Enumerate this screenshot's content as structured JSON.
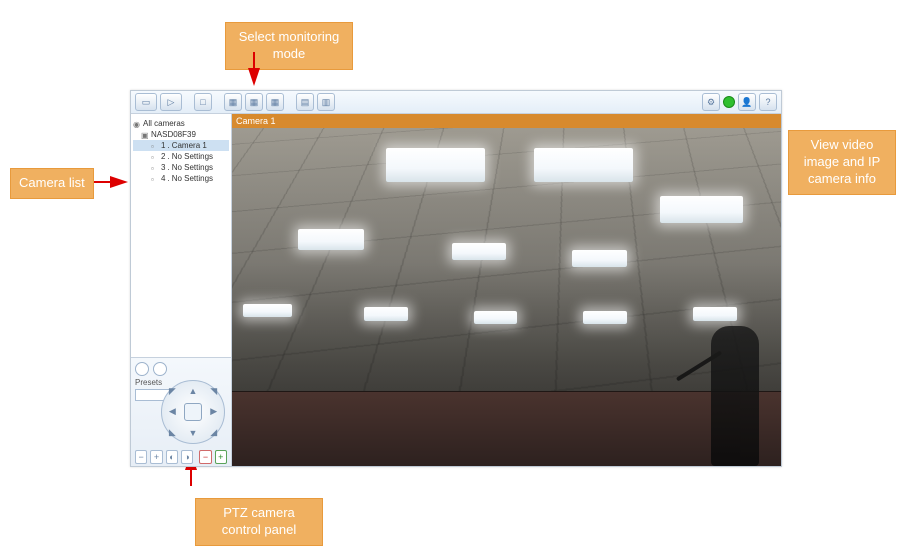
{
  "callouts": {
    "top": "Select monitoring mode",
    "left": "Camera list",
    "bottom": "PTZ camera control panel",
    "right": "View video image and IP camera info"
  },
  "toolbar": {
    "icons": {
      "monitor": "monitor-icon",
      "play": "play-icon",
      "layout_single": "layout-single-icon",
      "layout_2x2": "layout-2x2-icon",
      "layout_3x3": "layout-3x3-icon",
      "layout_seq": "layout-seq-icon",
      "layout_multi": "layout-multi-icon",
      "settings": "settings-icon",
      "snapshot": "snapshot-icon",
      "status": "status-icon",
      "user": "user-icon",
      "help": "help-icon"
    }
  },
  "tree": {
    "root": "All cameras",
    "server": "NASD08F39",
    "items": [
      {
        "idx": "1",
        "label": "Camera 1",
        "selected": true
      },
      {
        "idx": "2",
        "label": "No Settings"
      },
      {
        "idx": "3",
        "label": "No Settings"
      },
      {
        "idx": "4",
        "label": "No Settings"
      }
    ]
  },
  "ptz": {
    "presets_label": "Presets",
    "preset_value": ""
  },
  "camera": {
    "header": "Camera 1"
  }
}
